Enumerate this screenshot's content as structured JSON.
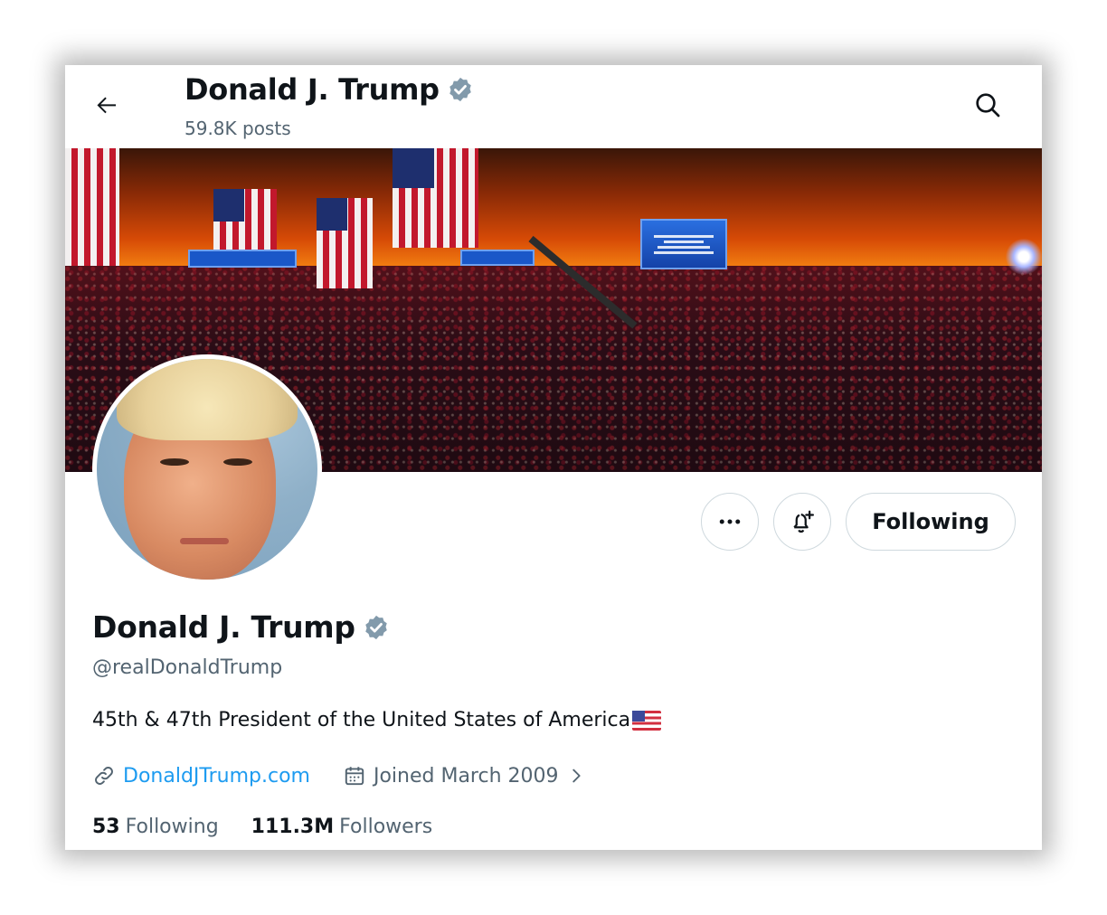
{
  "header": {
    "title": "Donald J. Trump",
    "posts_count": "59.8K posts",
    "back_icon": "arrow-left-icon",
    "search_icon": "search-icon"
  },
  "banner": {
    "description": "rally-crowd-banner"
  },
  "actions": {
    "more_icon": "more-horizontal-icon",
    "notify_icon": "bell-plus-icon",
    "follow_label": "Following"
  },
  "profile": {
    "name": "Donald J. Trump",
    "handle": "@realDonaldTrump",
    "bio": "45th & 47th President of the United States of America",
    "bio_emoji": "us-flag-icon",
    "website": "DonaldJTrump.com",
    "joined": "Joined March 2009"
  },
  "stats": {
    "following_count": "53",
    "following_label": "Following",
    "followers_count": "111.3M",
    "followers_label": "Followers"
  },
  "colors": {
    "verified": "#829aab",
    "link": "#1d9bf0",
    "muted": "#536471",
    "text": "#0f1419",
    "border": "#cfd9de"
  }
}
